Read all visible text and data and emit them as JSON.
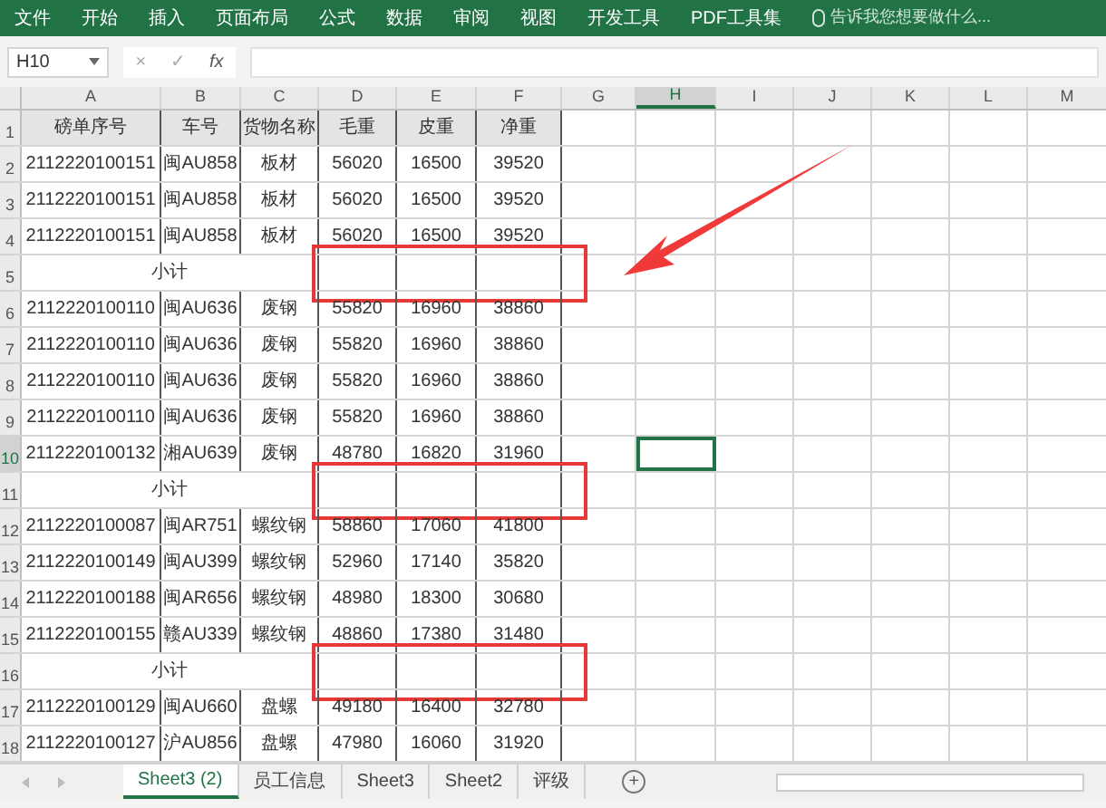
{
  "ribbon": {
    "tabs": [
      "文件",
      "开始",
      "插入",
      "页面布局",
      "公式",
      "数据",
      "审阅",
      "视图",
      "开发工具",
      "PDF工具集"
    ],
    "search": {
      "placeholder": "告诉我您想要做什么..."
    }
  },
  "formula_bar": {
    "name_box": "H10",
    "cancel": "×",
    "enter": "✓",
    "function": "fx"
  },
  "columns": [
    {
      "label": "A",
      "selected": false
    },
    {
      "label": "B",
      "selected": false
    },
    {
      "label": "C",
      "selected": false
    },
    {
      "label": "D",
      "selected": false
    },
    {
      "label": "E",
      "selected": false
    },
    {
      "label": "F",
      "selected": false
    },
    {
      "label": "G",
      "selected": false
    },
    {
      "label": "H",
      "selected": true
    },
    {
      "label": "I",
      "selected": false
    },
    {
      "label": "J",
      "selected": false
    },
    {
      "label": "K",
      "selected": false
    },
    {
      "label": "L",
      "selected": false
    },
    {
      "label": "M",
      "selected": false
    }
  ],
  "rows": [
    {
      "number": "1",
      "kind": "header",
      "selected": false,
      "cells": [
        "磅单序号",
        "车号",
        "货物名称",
        "毛重",
        "皮重",
        "净重"
      ]
    },
    {
      "number": "2",
      "kind": "data",
      "selected": false,
      "cells": [
        "2112220100151",
        "闽AU858",
        "板材",
        "56020",
        "16500",
        "39520"
      ]
    },
    {
      "number": "3",
      "kind": "data",
      "selected": false,
      "cells": [
        "2112220100151",
        "闽AU858",
        "板材",
        "56020",
        "16500",
        "39520"
      ]
    },
    {
      "number": "4",
      "kind": "data",
      "selected": false,
      "cells": [
        "2112220100151",
        "闽AU858",
        "板材",
        "56020",
        "16500",
        "39520"
      ]
    },
    {
      "number": "5",
      "kind": "subtotal",
      "selected": false,
      "highlighted": true,
      "cells": [
        "小计"
      ]
    },
    {
      "number": "6",
      "kind": "data",
      "selected": false,
      "cells": [
        "2112220100110",
        "闽AU636",
        "废钢",
        "55820",
        "16960",
        "38860"
      ]
    },
    {
      "number": "7",
      "kind": "data",
      "selected": false,
      "cells": [
        "2112220100110",
        "闽AU636",
        "废钢",
        "55820",
        "16960",
        "38860"
      ]
    },
    {
      "number": "8",
      "kind": "data",
      "selected": false,
      "cells": [
        "2112220100110",
        "闽AU636",
        "废钢",
        "55820",
        "16960",
        "38860"
      ]
    },
    {
      "number": "9",
      "kind": "data",
      "selected": false,
      "cells": [
        "2112220100110",
        "闽AU636",
        "废钢",
        "55820",
        "16960",
        "38860"
      ]
    },
    {
      "number": "10",
      "kind": "data",
      "selected": true,
      "cells": [
        "2112220100132",
        "湘AU639",
        "废钢",
        "48780",
        "16820",
        "31960"
      ]
    },
    {
      "number": "11",
      "kind": "subtotal",
      "selected": false,
      "highlighted": true,
      "cells": [
        "小计"
      ]
    },
    {
      "number": "12",
      "kind": "data",
      "selected": false,
      "cells": [
        "2112220100087",
        "闽AR751",
        "螺纹钢",
        "58860",
        "17060",
        "41800"
      ]
    },
    {
      "number": "13",
      "kind": "data",
      "selected": false,
      "cells": [
        "2112220100149",
        "闽AU399",
        "螺纹钢",
        "52960",
        "17140",
        "35820"
      ]
    },
    {
      "number": "14",
      "kind": "data",
      "selected": false,
      "cells": [
        "2112220100188",
        "闽AR656",
        "螺纹钢",
        "48980",
        "18300",
        "30680"
      ]
    },
    {
      "number": "15",
      "kind": "data",
      "selected": false,
      "cells": [
        "2112220100155",
        "赣AU339",
        "螺纹钢",
        "48860",
        "17380",
        "31480"
      ]
    },
    {
      "number": "16",
      "kind": "subtotal",
      "selected": false,
      "highlighted": true,
      "cells": [
        "小计"
      ]
    },
    {
      "number": "17",
      "kind": "data",
      "selected": false,
      "cells": [
        "2112220100129",
        "闽AU660",
        "盘螺",
        "49180",
        "16400",
        "32780"
      ]
    },
    {
      "number": "18",
      "kind": "data",
      "selected": false,
      "cells": [
        "2112220100127",
        "沪AU856",
        "盘螺",
        "47980",
        "16060",
        "31920"
      ]
    }
  ],
  "annotation_arrow": true,
  "sheet_tabs": [
    {
      "label": "Sheet3 (2)",
      "selected": true
    },
    {
      "label": "员工信息",
      "selected": false
    },
    {
      "label": "Sheet3",
      "selected": false
    },
    {
      "label": "Sheet2",
      "selected": false
    },
    {
      "label": "评级",
      "selected": false
    }
  ],
  "add_sheet": "+"
}
